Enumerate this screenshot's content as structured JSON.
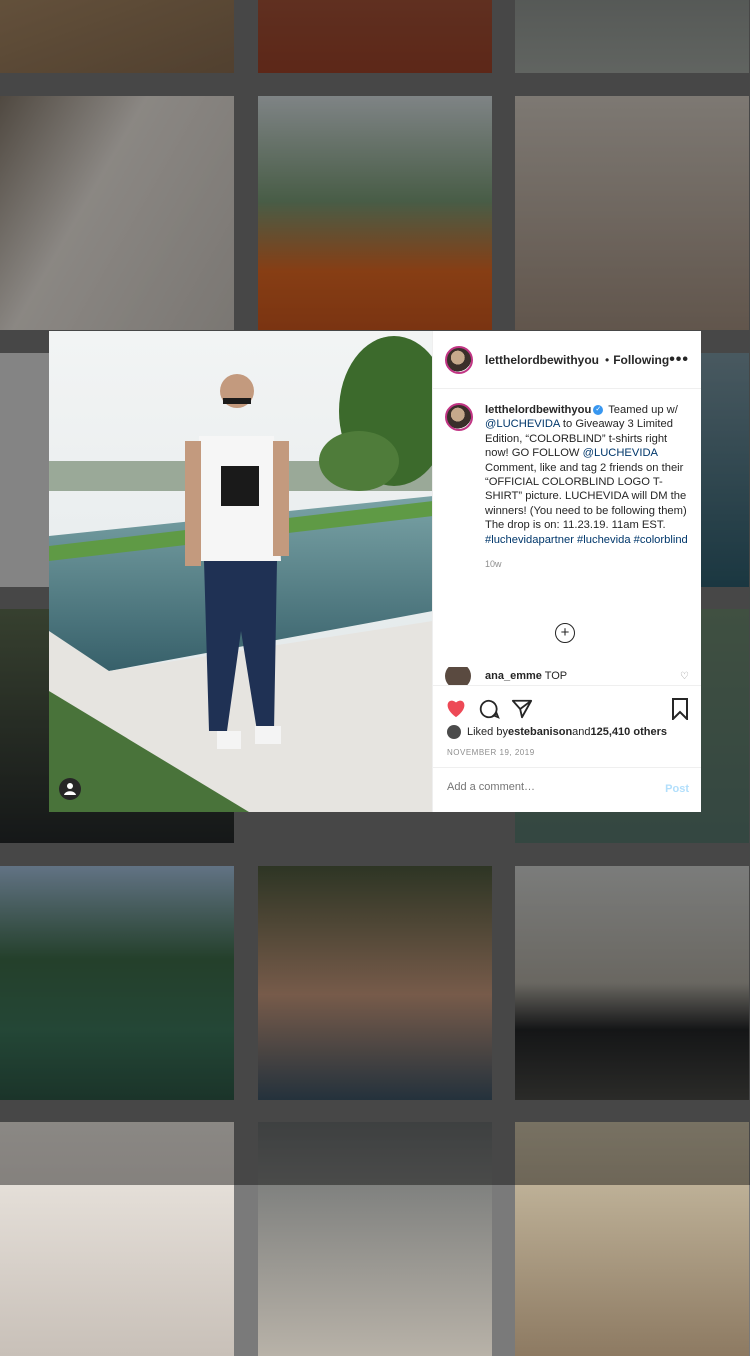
{
  "grid": {
    "tiles": [
      {
        "name": "donuts-photo",
        "bg": "#9b8b78"
      },
      {
        "name": "table-box-photo",
        "bg": "#a65a3a"
      },
      {
        "name": "jeans-sofa-photo",
        "bg": "#8a8f88"
      },
      {
        "name": "mirror-selfie-photo",
        "bg": "#cfc8c0"
      },
      {
        "name": "father-son-selfie-photo",
        "bg": "#dd6a2a"
      },
      {
        "name": "child-on-sofa-photo",
        "bg": "#b9a99a"
      },
      {
        "name": "storefront-photo",
        "bg": "#d6d6d6"
      },
      {
        "name": "pool-view-photo",
        "bg": "#4f6a78"
      },
      {
        "name": "golf-car-photo",
        "bg": "#3c4a3a"
      },
      {
        "name": "pool-shoes-photo",
        "bg": "#5e7a6a"
      },
      {
        "name": "lake-house-photo",
        "bg": "#3f6a56"
      },
      {
        "name": "sunglasses-portrait-photo",
        "bg": "#4a5a68"
      },
      {
        "name": "black-suv-photo",
        "bg": "#2e3236"
      },
      {
        "name": "bed-photo",
        "bg": "#d8d2cc"
      },
      {
        "name": "car-interior-photo",
        "bg": "#6a6a66"
      },
      {
        "name": "hotel-portrait-photo",
        "bg": "#bfb8a8"
      }
    ]
  },
  "post": {
    "username": "letthelordbewithyou",
    "dot": "•",
    "following_label": "Following",
    "more_label": "•••",
    "caption": {
      "username": "letthelordbewithyou",
      "verified_glyph": "✓",
      "text_1": "Teamed up w/ ",
      "mention_1": "@LUCHEVIDA",
      "text_2": " to Giveaway 3 Limited Edition, “COLORBLIND” t-shirts right now! GO FOLLOW ",
      "mention_2": "@LUCHEVIDA",
      "text_3": " Comment, like and tag 2 friends on their “OFFICIAL COLORBLIND LOGO T-SHIRT” picture. LUCHEVIDA will DM the winners! (You need to be following them) The drop is on: 11.23.19. 11am EST. ",
      "hashtag_1": "#luchevidapartner",
      "hashtag_2": "#luchevida",
      "hashtag_3": "#colorblind"
    },
    "age": "10w",
    "load_more_glyph": "+",
    "comment": {
      "username": "ana_emme",
      "text": "TOP"
    },
    "likes": {
      "prefix": "Liked by ",
      "user": "estebanison",
      "middle": " and ",
      "count": "125,410 others"
    },
    "date": "NOVEMBER 19, 2019",
    "add_comment_placeholder": "Add a comment…",
    "post_label": "Post",
    "liked_color": "#ed4956"
  }
}
